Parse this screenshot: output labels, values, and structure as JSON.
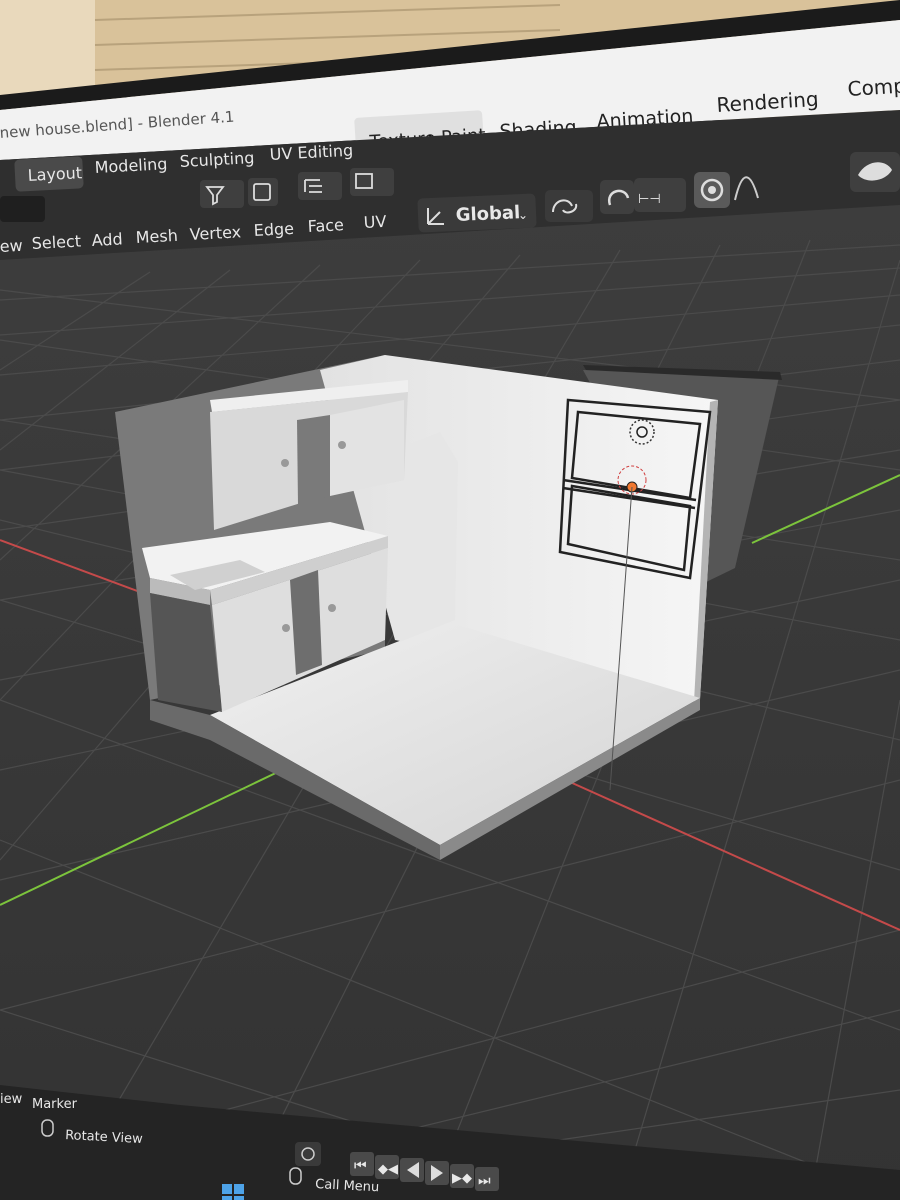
{
  "window": {
    "title": "new house.blend] - Blender 4.1",
    "top_tabs": [
      "Texture Paint",
      "Shading",
      "Animation",
      "Rendering",
      "Comp"
    ]
  },
  "workspace_tabs": {
    "active": "Layout",
    "items": [
      "Layout",
      "Modeling",
      "Sculpting",
      "UV Editing"
    ]
  },
  "header_menu": [
    "ew",
    "Select",
    "Add",
    "Mesh",
    "Vertex",
    "Edge",
    "Face",
    "UV"
  ],
  "transform_orientation": "Global",
  "timeline": {
    "menu_partial": "iew",
    "marker_label": "Marker",
    "status_rotate": "Rotate View",
    "status_call_menu": "Call Menu"
  },
  "colors": {
    "top_bar": "#f2f2f2",
    "header": "#303030",
    "viewport": "#3a3a3a",
    "grid": "#4a4a4a",
    "x_axis": "#c44a4a",
    "y_axis": "#7cc43c",
    "model": "#d8d8d8"
  }
}
